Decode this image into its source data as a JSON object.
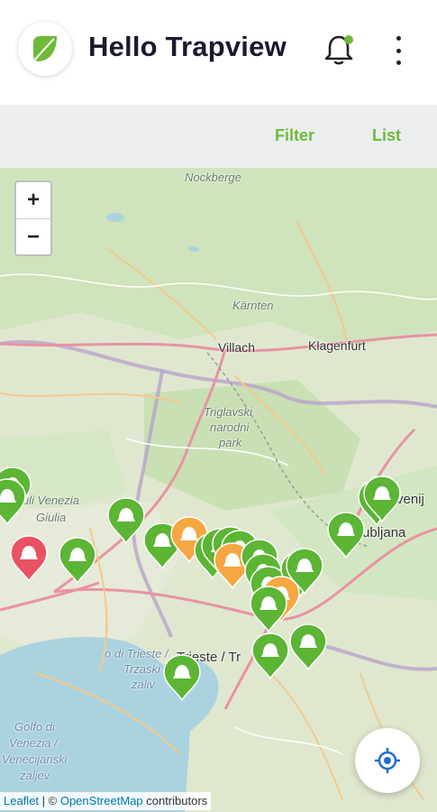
{
  "app": {
    "title": "Hello Trapview",
    "brand_color": "#6fba3a"
  },
  "header": {
    "logo_icon": "leaf-logo-icon",
    "notification_icon": "bell-icon",
    "menu_icon": "more-vertical-icon"
  },
  "toolbar": {
    "filter_label": "Filter",
    "list_label": "List"
  },
  "map": {
    "zoom_in_label": "+",
    "zoom_out_label": "−",
    "labels": {
      "nockberge": "Nockberge",
      "karnten": "Kärnten",
      "villach": "Villach",
      "klagenfurt": "Klagenfurt",
      "triglav_1": "Triglavski",
      "triglav_2": "narodni",
      "triglav_3": "park",
      "friuli_1": "iuli Venezia",
      "friuli_2": "Giulia",
      "trieste": "Trieste / Tr",
      "golfo_trieste_1": "o di Trieste /",
      "golfo_trieste_2": "Trzaski",
      "golfo_trieste_3": "zaliv",
      "golfo_venezia_1": "Golfo di",
      "golfo_venezia_2": "Venezia /",
      "golfo_venezia_3": "Venecijanski",
      "golfo_venezia_4": "zaljev",
      "ljubljana": "ubljana",
      "slovenija": "venij"
    },
    "marker_colors": {
      "ok": "#5cb535",
      "warning": "#f5a742",
      "alert": "#e95262"
    },
    "locate_icon": "crosshair-locate-icon"
  },
  "attribution": {
    "leaflet": "Leaflet",
    "separator": " | © ",
    "osm": "OpenStreetMap",
    "suffix": " contributors"
  }
}
